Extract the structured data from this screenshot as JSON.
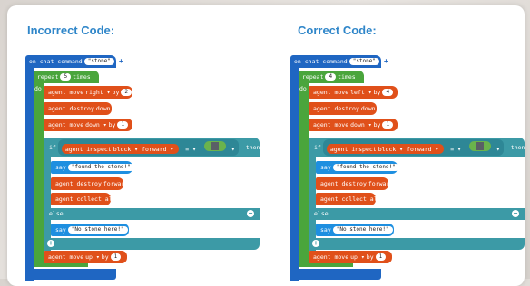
{
  "titles": {
    "incorrect": "Incorrect Code:",
    "correct": "Correct Code:"
  },
  "incorrect": {
    "on_chat": "on chat command",
    "chat_arg": "\"stone\"",
    "repeat": "repeat",
    "repeat_count": "5",
    "times": "times",
    "do": "do",
    "move1_label": "agent move",
    "move1_dir": "right ▾",
    "by": "by",
    "move1_by": "2",
    "destroy1_label": "agent destroy",
    "destroy1_dir": "down ▾",
    "move2_label": "agent move",
    "move2_dir": "down ▾",
    "move2_by": "1",
    "if": "if",
    "inspect_label": "agent inspect",
    "inspect_what": "block ▾",
    "inspect_dir": "forward ▾",
    "eq": "= ▾",
    "then": "then",
    "say1_label": "say",
    "say1_text": "\"found the stone!\"",
    "destroy2_label": "agent destroy",
    "destroy2_dir": "forward ▾",
    "collect_label": "agent collect all",
    "else": "else",
    "say2_label": "say",
    "say2_text": "\"No stone here!\"",
    "move3_label": "agent move",
    "move3_dir": "up ▾",
    "move3_by": "1"
  },
  "correct": {
    "on_chat": "on chat command",
    "chat_arg": "\"stone\"",
    "repeat": "repeat",
    "repeat_count": "4",
    "times": "times",
    "do": "do",
    "move1_label": "agent move",
    "move1_dir": "left ▾",
    "by": "by",
    "move1_by": "4",
    "destroy1_label": "agent destroy",
    "destroy1_dir": "down ▾",
    "move2_label": "agent move",
    "move2_dir": "down ▾",
    "move2_by": "1",
    "if": "if",
    "inspect_label": "agent inspect",
    "inspect_what": "block ▾",
    "inspect_dir": "forward ▾",
    "eq": "= ▾",
    "then": "then",
    "say1_label": "say",
    "say1_text": "\"found the stone!\"",
    "destroy2_label": "agent destroy",
    "destroy2_dir": "forward ▾",
    "collect_label": "agent collect all",
    "else": "else",
    "say2_label": "say",
    "say2_text": "\"No stone here!\"",
    "move3_label": "agent move",
    "move3_dir": "up ▾",
    "move3_by": "1"
  },
  "icons": {
    "add": "plus-circle-icon",
    "remove": "minus-circle-icon",
    "block": "stone-block-icon"
  },
  "colors": {
    "title": "#2f86c9",
    "event_block": "#1f66c2",
    "loop_block": "#4aa53c",
    "agent_block": "#e0501a",
    "logic_block": "#3c9aa6",
    "say_block": "#1e8fe0"
  }
}
